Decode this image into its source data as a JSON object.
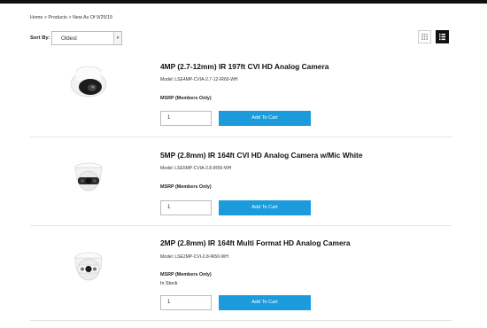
{
  "breadcrumb": {
    "home": "Home",
    "sep1": ">",
    "products": "Products",
    "sep2": ">",
    "current": "New As Of 9/25/19"
  },
  "sort": {
    "label": "Sort By:",
    "value": "Oldest"
  },
  "view": {
    "grid_icon": "grid-view-icon",
    "list_icon": "list-view-icon",
    "active": "list"
  },
  "colors": {
    "accent": "#1b9bdc",
    "topbar": "#111111"
  },
  "products": [
    {
      "title": "4MP (2.7-12mm) IR 197ft CVI HD Analog Camera",
      "model": "Model: LSE4MP-CVIA-2.7-12-IR60-WH",
      "msrp": "MSRP (Members Only)",
      "stock": "",
      "qty": "1",
      "button": "Add To Cart",
      "image": "bullet-dome-camera-image"
    },
    {
      "title": "5MP (2.8mm) IR 164ft CVI HD Analog Camera w/Mic White",
      "model": "Model: LSE5MP-CVIA-2.8-IR50-WH",
      "msrp": "MSRP (Members Only)",
      "stock": "",
      "qty": "1",
      "button": "Add To Cart",
      "image": "turret-camera-image"
    },
    {
      "title": "2MP (2.8mm) IR 164ft Multi Format HD Analog Camera",
      "model": "Model: LSE2MP-CVI-2.8-IR50-WH",
      "msrp": "MSRP (Members Only)",
      "stock": "In Stock",
      "qty": "1",
      "button": "Add To Cart",
      "image": "turret-camera-image"
    }
  ]
}
